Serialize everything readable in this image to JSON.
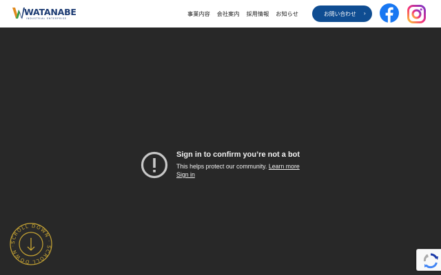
{
  "header": {
    "logo": {
      "name": "WATANABE",
      "tagline": "INDUSTRIAL ENTERPRISE"
    },
    "nav": [
      {
        "label": "事業内容"
      },
      {
        "label": "会社案内"
      },
      {
        "label": "採用情報"
      },
      {
        "label": "お知らせ"
      }
    ],
    "contact_button": {
      "label": "お問い合わせ",
      "chevron": "›"
    },
    "social": [
      {
        "icon": "facebook-icon",
        "color": "#1877f2"
      },
      {
        "icon": "instagram-icon",
        "color": "#d6249f"
      }
    ],
    "accent_color": "#0f4d92"
  },
  "message": {
    "icon": "alert-circle-icon",
    "title": "Sign in to confirm you’re not a bot",
    "body": "This helps protect our community.",
    "learn_more": "Learn more",
    "sign_in": "Sign in"
  },
  "scroll_badge": {
    "text": "SCROLL DOWN · SCROLL DOWN ·",
    "icon": "arrow-down-icon",
    "color": "#c9a634"
  },
  "recaptcha": {
    "icon": "recaptcha-icon"
  },
  "background_color": "#282828"
}
